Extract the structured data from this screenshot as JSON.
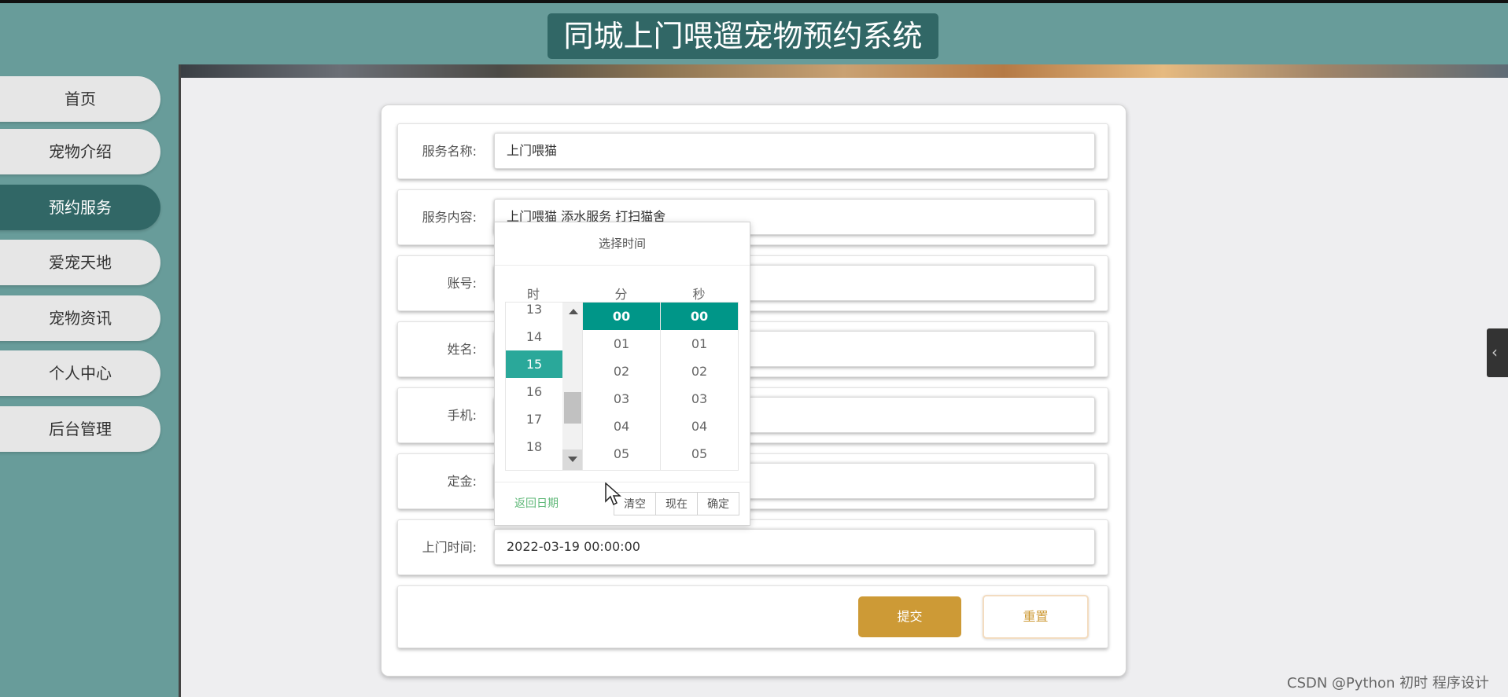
{
  "header": {
    "title": "同城上门喂遛宠物预约系统"
  },
  "sidebar": {
    "active_index": 2,
    "items": [
      {
        "label": "首页"
      },
      {
        "label": "宠物介绍"
      },
      {
        "label": "预约服务"
      },
      {
        "label": "爱宠天地"
      },
      {
        "label": "宠物资讯"
      },
      {
        "label": "个人中心"
      },
      {
        "label": "后台管理"
      }
    ]
  },
  "form": {
    "service_name": {
      "label": "服务名称:",
      "value": "上门喂猫"
    },
    "service_content": {
      "label": "服务内容:",
      "value": "上门喂猫 添水服务 打扫猫舍"
    },
    "account": {
      "label": "账号:",
      "value": ""
    },
    "name": {
      "label": "姓名:",
      "value": ""
    },
    "phone": {
      "label": "手机:",
      "value": ""
    },
    "deposit": {
      "label": "定金:",
      "value": ""
    },
    "visit_time": {
      "label": "上门时间:",
      "value": "2022-03-19 00:00:00"
    },
    "submit_label": "提交",
    "reset_label": "重置"
  },
  "time_picker": {
    "title": "选择时间",
    "col_hour": "时",
    "col_minute": "分",
    "col_second": "秒",
    "hours": [
      "13",
      "14",
      "15",
      "16",
      "17",
      "18"
    ],
    "selected_hour": "15",
    "minutes": [
      "00",
      "01",
      "02",
      "03",
      "04",
      "05"
    ],
    "selected_minute": "00",
    "seconds": [
      "00",
      "01",
      "02",
      "03",
      "04",
      "05"
    ],
    "selected_second": "00",
    "back_to_date": "返回日期",
    "clear_label": "清空",
    "now_label": "现在",
    "confirm_label": "确定"
  },
  "watermark": "CSDN @Python 初时 程序设计",
  "colors": {
    "header_bg": "#689c9a",
    "title_bg": "#316766",
    "active_nav": "#316766",
    "submit_button": "#cd9a36",
    "picker_selected": "#009688",
    "back_link": "#5fb878"
  },
  "icons": {
    "side_toggle": "chevron-left-icon",
    "cursor": "mouse-pointer-icon"
  }
}
